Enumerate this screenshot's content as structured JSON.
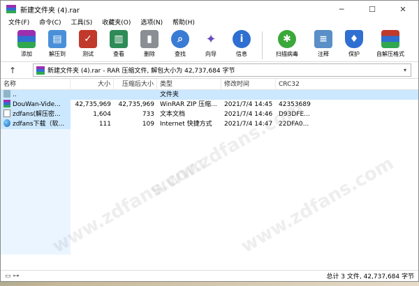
{
  "window": {
    "title": "新建文件夹 (4).rar",
    "minimize": "─",
    "maximize": "☐",
    "close": "✕"
  },
  "menu": [
    "文件(F)",
    "命令(C)",
    "工具(S)",
    "收藏夹(O)",
    "选项(N)",
    "帮助(H)"
  ],
  "toolbar": {
    "add": "添加",
    "extract_to": "解压到",
    "test": "测试",
    "view": "查看",
    "delete": "删除",
    "find": "查找",
    "wizard": "向导",
    "info": "信息",
    "virus_scan": "扫描病毒",
    "comment": "注释",
    "protect": "保护",
    "sfx": "自解压格式"
  },
  "address": {
    "up": "↑",
    "text": "新建文件夹 (4).rar - RAR 压缩文件, 解包大小为 42,737,684 字节",
    "dropdown": "▾"
  },
  "columns": {
    "name": "名称",
    "size": "大小",
    "packed": "压缩后大小",
    "type": "类型",
    "modified": "修改时间",
    "crc": "CRC32"
  },
  "rows": [
    {
      "name": "..",
      "size": "",
      "packed": "",
      "type": "文件夹",
      "modified": "",
      "crc": "",
      "icon": "folder"
    },
    {
      "name": "DouWan-Vide...",
      "size": "42,735,969",
      "packed": "42,735,969",
      "type": "WinRAR ZIP 压缩...",
      "modified": "2021/7/4 14:45",
      "crc": "42353689",
      "icon": "rar"
    },
    {
      "name": "zdfans(解压密...",
      "size": "1,604",
      "packed": "733",
      "type": "文本文档",
      "modified": "2021/7/4 14:46",
      "crc": "D93DFE...",
      "icon": "txt"
    },
    {
      "name": "zdfans下载（软...",
      "size": "111",
      "packed": "109",
      "type": "Internet 快捷方式",
      "modified": "2021/7/4 14:47",
      "crc": "22DFA0...",
      "icon": "url"
    }
  ],
  "watermark": "www.zdfans.com",
  "status": {
    "icons": "▭ ⊶",
    "text": "总计 3 文件, 42,737,684 字节"
  }
}
